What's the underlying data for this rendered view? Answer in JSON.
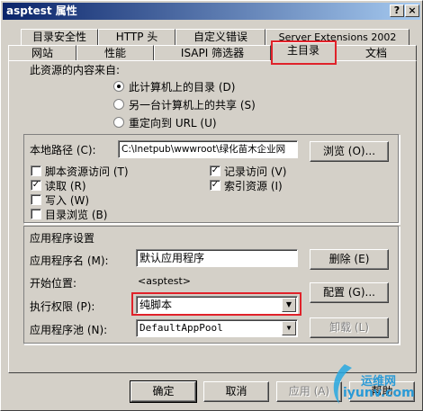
{
  "window": {
    "title": "asptest 属性",
    "help_btn": "?",
    "close_btn": "×"
  },
  "tabs": {
    "row1": [
      "目录安全性",
      "HTTP 头",
      "自定义错误",
      "Server Extensions 2002"
    ],
    "row2": [
      "网站",
      "性能",
      "ISAPI 筛选器",
      "主目录",
      "文档"
    ]
  },
  "source": {
    "heading": "此资源的内容来自:",
    "options": [
      "此计算机上的目录 (D)",
      "另一台计算机上的共享 (S)",
      "重定向到 URL (U)"
    ]
  },
  "local_path": {
    "label": "本地路径 (C):",
    "value": "C:\\Inetpub\\wwwroot\\绿化苗木企业网",
    "browse": "浏览 (O)..."
  },
  "checks": {
    "script_access": "脚本资源访问 (T)",
    "read": "读取 (R)",
    "write": "写入 (W)",
    "dir_browse": "目录浏览 (B)",
    "log_visits": "记录访问 (V)",
    "index_resource": "索引资源 (I)"
  },
  "app": {
    "heading": "应用程序设置",
    "name_label": "应用程序名 (M):",
    "name_value": "默认应用程序",
    "remove_btn": "删除 (E)",
    "start_label": "开始位置:",
    "start_value": "<asptest>",
    "config_btn": "配置 (G)...",
    "exec_label": "执行权限 (P):",
    "exec_value": "纯脚本",
    "pool_label": "应用程序池 (N):",
    "pool_value": "DefaultAppPool",
    "unload_btn": "卸载 (L)"
  },
  "footer": {
    "ok": "确定",
    "cancel": "取消",
    "apply": "应用 (A)",
    "help": "帮助"
  },
  "watermark": {
    "cn": "运维网",
    "en": "iyunv.com"
  },
  "colors": {
    "highlight": "#e0222a",
    "face": "#d4d0c8",
    "title_from": "#0a246a",
    "title_to": "#a6caf0"
  }
}
